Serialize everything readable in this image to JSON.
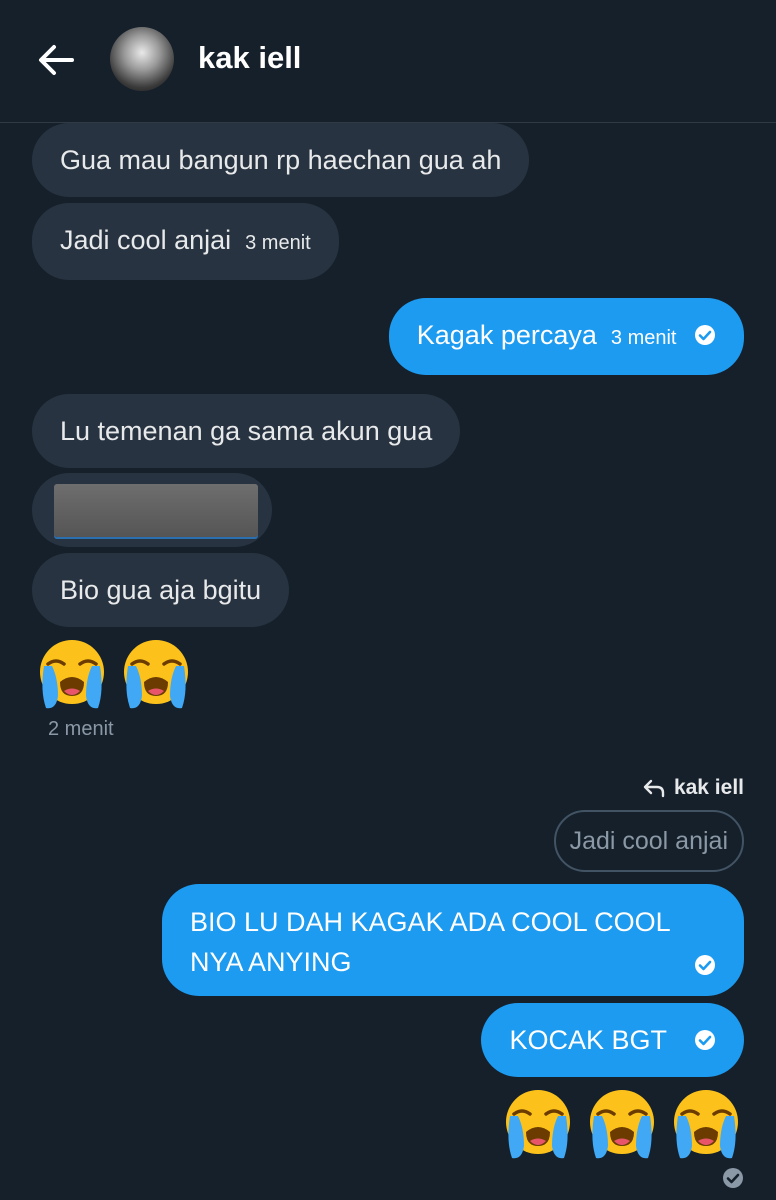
{
  "header": {
    "contact_name": "kak iell"
  },
  "messages": {
    "m1": {
      "text": "Gua mau bangun rp haechan gua ah"
    },
    "m2": {
      "text": "Jadi cool anjai",
      "time": "3 menit"
    },
    "m3": {
      "text": "Kagak percaya",
      "time": "3 menit"
    },
    "m4": {
      "text": "Lu temenan ga sama akun gua"
    },
    "m6": {
      "text": "Bio gua aja bgitu"
    },
    "m7": {
      "time": "2 menit"
    },
    "reply": {
      "label": "kak iell",
      "quoted": "Jadi cool anjai"
    },
    "m8": {
      "line1": "BIO LU DAH KAGAK ADA COOL COOL",
      "line2": "NYA ANYING"
    },
    "m9": {
      "text": "KOCAK BGT"
    }
  },
  "icons": {
    "back": "arrow-left-icon",
    "check": "check-circle-icon",
    "reply": "reply-arrow-icon",
    "emoji": "loudly-crying-face-emoji"
  },
  "colors": {
    "background": "#15202b",
    "incoming_bubble": "#273340",
    "outgoing_bubble": "#1d9bf0",
    "muted_text": "#8b98a5"
  }
}
